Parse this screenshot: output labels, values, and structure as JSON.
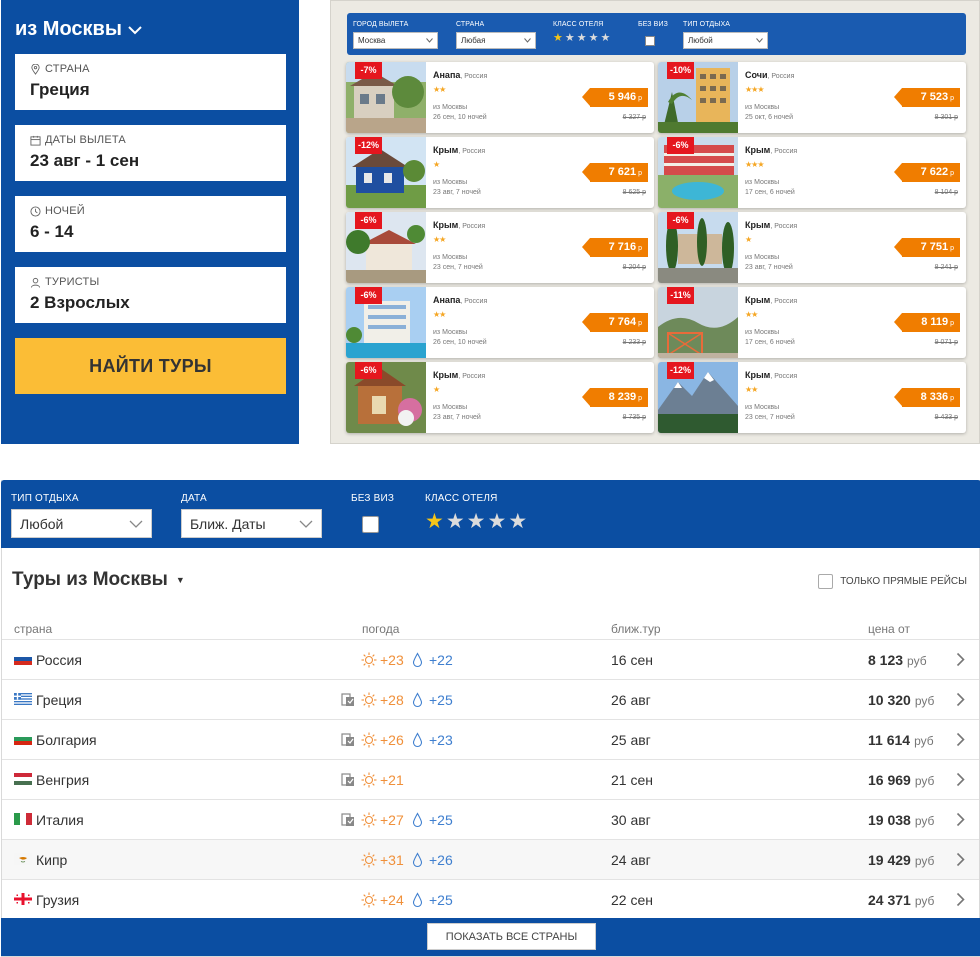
{
  "search": {
    "city": "из Москвы",
    "country": {
      "label": "СТРАНА",
      "value": "Греция"
    },
    "dates": {
      "label": "ДАТЫ ВЫЛЕТА",
      "value": "23 авг - 1 сен"
    },
    "nights": {
      "label": "НОЧЕЙ",
      "value": "6 - 14"
    },
    "tourists": {
      "label": "ТУРИСТЫ",
      "value": "2 Взрослых"
    },
    "find_button": "НАЙТИ ТУРЫ"
  },
  "deals": {
    "filters": {
      "city_label": "ГОРОД ВЫЛЕТА",
      "city_value": "Москва",
      "country_label": "СТРАНА",
      "country_value": "Любая",
      "class_label": "КЛАСС ОТЕЛЯ",
      "novisa_label": "БЕЗ ВИЗ",
      "type_label": "ТИП ОТДЫХА",
      "type_value": "Любой"
    },
    "cards": [
      {
        "title": "Анапа",
        "country": ", Россия",
        "stars": "★★",
        "discount": "-7%",
        "from": "из Москвы",
        "when": "26 сен, 10 ночей",
        "price": "5 946",
        "cur": " р",
        "old": "6 327 р",
        "photo": "house"
      },
      {
        "title": "Сочи",
        "country": ", Россия",
        "stars": "★★★",
        "discount": "-10%",
        "from": "из Москвы",
        "when": "25 окт, 6 ночей",
        "price": "7 523",
        "cur": " р",
        "old": "8 301 р",
        "photo": "tower"
      },
      {
        "title": "Крым",
        "country": ", Россия",
        "stars": "★",
        "discount": "-12%",
        "from": "из Москвы",
        "when": "23 авг, 7 ночей",
        "price": "7 621",
        "cur": " р",
        "old": "8 625 р",
        "photo": "bluehouse"
      },
      {
        "title": "Крым",
        "country": ", Россия",
        "stars": "★★★",
        "discount": "-6%",
        "from": "из Москвы",
        "when": "17 сен, 6 ночей",
        "price": "7 622",
        "cur": " р",
        "old": "8 104 р",
        "photo": "pool"
      },
      {
        "title": "Крым",
        "country": ", Россия",
        "stars": "★★",
        "discount": "-6%",
        "from": "из Москвы",
        "when": "23 сен, 7 ночей",
        "price": "7 716",
        "cur": " р",
        "old": "8 204 р",
        "photo": "trees"
      },
      {
        "title": "Крым",
        "country": ", Россия",
        "stars": "★",
        "discount": "-6%",
        "from": "из Москвы",
        "when": "23 авг, 7 ночей",
        "price": "7 751",
        "cur": " р",
        "old": "8 241 р",
        "photo": "cypress"
      },
      {
        "title": "Анапа",
        "country": ", Россия",
        "stars": "★★",
        "discount": "-6%",
        "from": "из Москвы",
        "when": "26 сен, 10 ночей",
        "price": "7 764",
        "cur": " р",
        "old": "8 233 р",
        "photo": "hotel"
      },
      {
        "title": "Крым",
        "country": ", Россия",
        "stars": "★★",
        "discount": "-11%",
        "from": "из Москвы",
        "when": "17 сен, 6 ночей",
        "price": "8 119",
        "cur": " р",
        "old": "9 071 р",
        "photo": "hills"
      },
      {
        "title": "Крым",
        "country": ", Россия",
        "stars": "★",
        "discount": "-6%",
        "from": "из Москвы",
        "when": "23 авг, 7 ночей",
        "price": "8 239",
        "cur": " р",
        "old": "8 735 р",
        "photo": "cabin"
      },
      {
        "title": "Крым",
        "country": ", Россия",
        "stars": "★★",
        "discount": "-12%",
        "from": "из Москвы",
        "when": "23 сен, 7 ночей",
        "price": "8 336",
        "cur": " р",
        "old": "9 433 р",
        "photo": "mountain"
      }
    ]
  },
  "tours": {
    "filters": {
      "type_label": "ТИП ОТДЫХА",
      "type_value": "Любой",
      "date_label": "ДАТА",
      "date_value": "Ближ. Даты",
      "novisa_label": "БЕЗ ВИЗ",
      "class_label": "КЛАСС ОТЕЛЯ"
    },
    "title": "Туры из Москвы",
    "direct_label": "ТОЛЬКО ПРЯМЫЕ РЕЙСЫ",
    "columns": {
      "country": "страна",
      "weather": "погода",
      "nearest": "ближ.тур",
      "price": "цена от"
    },
    "rows": [
      {
        "country": "Россия",
        "flag": "ru",
        "visa": false,
        "air": "+23",
        "sea": "+22",
        "date": "16 сен",
        "price": "8 123",
        "cur": "руб"
      },
      {
        "country": "Греция",
        "flag": "gr",
        "visa": true,
        "air": "+28",
        "sea": "+25",
        "date": "26 авг",
        "price": "10 320",
        "cur": "руб"
      },
      {
        "country": "Болгария",
        "flag": "bg",
        "visa": true,
        "air": "+26",
        "sea": "+23",
        "date": "25 авг",
        "price": "11 614",
        "cur": "руб"
      },
      {
        "country": "Венгрия",
        "flag": "hu",
        "visa": true,
        "air": "+21",
        "sea": "",
        "date": "21 сен",
        "price": "16 969",
        "cur": "руб"
      },
      {
        "country": "Италия",
        "flag": "it",
        "visa": true,
        "air": "+27",
        "sea": "+25",
        "date": "30 авг",
        "price": "19 038",
        "cur": "руб"
      },
      {
        "country": "Кипр",
        "flag": "cy",
        "visa": false,
        "air": "+31",
        "sea": "+26",
        "date": "24 авг",
        "price": "19 429",
        "cur": "руб"
      },
      {
        "country": "Грузия",
        "flag": "ge",
        "visa": false,
        "air": "+24",
        "sea": "+25",
        "date": "22 сен",
        "price": "24 371",
        "cur": "руб"
      }
    ],
    "show_all": "ПОКАЗАТЬ ВСЕ СТРАНЫ"
  },
  "colors": {
    "brand_blue": "#0b4ea2",
    "find_yellow": "#fbbd36",
    "price_orange": "#f07d00",
    "discount_red": "#e5161e",
    "star_gold": "#f5a623"
  }
}
